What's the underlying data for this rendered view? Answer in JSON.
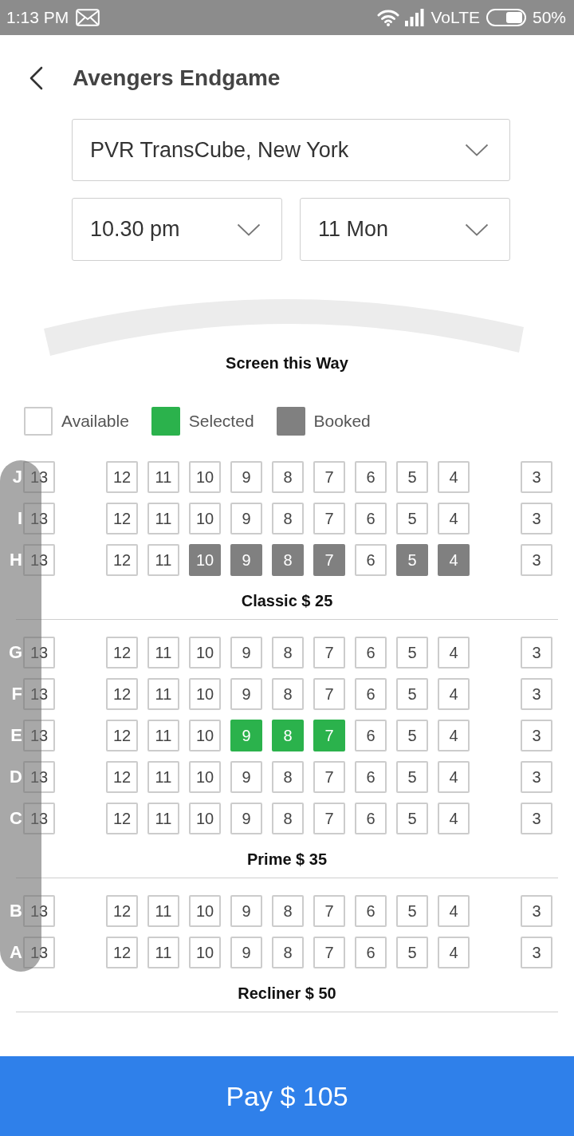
{
  "status_bar": {
    "time": "1:13 PM",
    "network": "VoLTE",
    "battery": "50%"
  },
  "header": {
    "title": "Avengers Endgame"
  },
  "filters": {
    "theatre": {
      "value": "PVR TransCube, New York"
    },
    "show_time": {
      "value": "10.30 pm"
    },
    "show_date": {
      "value": "11 Mon"
    }
  },
  "screen": {
    "label": "Screen this Way"
  },
  "legend": [
    {
      "kind": "available",
      "label": "Available"
    },
    {
      "kind": "selected",
      "label": "Selected"
    },
    {
      "kind": "booked",
      "label": "Booked"
    }
  ],
  "sections": [
    {
      "label": "Classic $ 25",
      "rows": [
        {
          "letter": "J",
          "blocks": [
            {
              "seats": [
                {
                  "number": "13",
                  "selected": false,
                  "booked": false
                }
              ]
            },
            {
              "seats": [
                {
                  "number": "12",
                  "selected": false,
                  "booked": false
                },
                {
                  "number": "11",
                  "selected": false,
                  "booked": false
                },
                {
                  "number": "10",
                  "selected": false,
                  "booked": false
                },
                {
                  "number": "9",
                  "selected": false,
                  "booked": false
                },
                {
                  "number": "8",
                  "selected": false,
                  "booked": false
                },
                {
                  "number": "7",
                  "selected": false,
                  "booked": false
                },
                {
                  "number": "6",
                  "selected": false,
                  "booked": false
                },
                {
                  "number": "5",
                  "selected": false,
                  "booked": false
                },
                {
                  "number": "4",
                  "selected": false,
                  "booked": false
                }
              ]
            },
            {
              "seats": [
                {
                  "number": "3",
                  "selected": false,
                  "booked": false
                }
              ]
            }
          ]
        },
        {
          "letter": "I",
          "blocks": [
            {
              "seats": [
                {
                  "number": "13",
                  "selected": false,
                  "booked": false
                }
              ]
            },
            {
              "seats": [
                {
                  "number": "12",
                  "selected": false,
                  "booked": false
                },
                {
                  "number": "11",
                  "selected": false,
                  "booked": false
                },
                {
                  "number": "10",
                  "selected": false,
                  "booked": false
                },
                {
                  "number": "9",
                  "selected": false,
                  "booked": false
                },
                {
                  "number": "8",
                  "selected": false,
                  "booked": false
                },
                {
                  "number": "7",
                  "selected": false,
                  "booked": false
                },
                {
                  "number": "6",
                  "selected": false,
                  "booked": false
                },
                {
                  "number": "5",
                  "selected": false,
                  "booked": false
                },
                {
                  "number": "4",
                  "selected": false,
                  "booked": false
                }
              ]
            },
            {
              "seats": [
                {
                  "number": "3",
                  "selected": false,
                  "booked": false
                }
              ]
            }
          ]
        },
        {
          "letter": "H",
          "blocks": [
            {
              "seats": [
                {
                  "number": "13",
                  "selected": false,
                  "booked": false
                }
              ]
            },
            {
              "seats": [
                {
                  "number": "12",
                  "selected": false,
                  "booked": false
                },
                {
                  "number": "11",
                  "selected": false,
                  "booked": false
                },
                {
                  "number": "10",
                  "selected": false,
                  "booked": true
                },
                {
                  "number": "9",
                  "selected": false,
                  "booked": true
                },
                {
                  "number": "8",
                  "selected": false,
                  "booked": true
                },
                {
                  "number": "7",
                  "selected": false,
                  "booked": true
                },
                {
                  "number": "6",
                  "selected": false,
                  "booked": false
                },
                {
                  "number": "5",
                  "selected": false,
                  "booked": true
                },
                {
                  "number": "4",
                  "selected": false,
                  "booked": true
                }
              ]
            },
            {
              "seats": [
                {
                  "number": "3",
                  "selected": false,
                  "booked": false
                }
              ]
            }
          ]
        }
      ]
    },
    {
      "label": "Prime $ 35",
      "rows": [
        {
          "letter": "G",
          "blocks": [
            {
              "seats": [
                {
                  "number": "13",
                  "selected": false,
                  "booked": false
                }
              ]
            },
            {
              "seats": [
                {
                  "number": "12",
                  "selected": false,
                  "booked": false
                },
                {
                  "number": "11",
                  "selected": false,
                  "booked": false
                },
                {
                  "number": "10",
                  "selected": false,
                  "booked": false
                },
                {
                  "number": "9",
                  "selected": false,
                  "booked": false
                },
                {
                  "number": "8",
                  "selected": false,
                  "booked": false
                },
                {
                  "number": "7",
                  "selected": false,
                  "booked": false
                },
                {
                  "number": "6",
                  "selected": false,
                  "booked": false
                },
                {
                  "number": "5",
                  "selected": false,
                  "booked": false
                },
                {
                  "number": "4",
                  "selected": false,
                  "booked": false
                }
              ]
            },
            {
              "seats": [
                {
                  "number": "3",
                  "selected": false,
                  "booked": false
                }
              ]
            }
          ]
        },
        {
          "letter": "F",
          "blocks": [
            {
              "seats": [
                {
                  "number": "13",
                  "selected": false,
                  "booked": false
                }
              ]
            },
            {
              "seats": [
                {
                  "number": "12",
                  "selected": false,
                  "booked": false
                },
                {
                  "number": "11",
                  "selected": false,
                  "booked": false
                },
                {
                  "number": "10",
                  "selected": false,
                  "booked": false
                },
                {
                  "number": "9",
                  "selected": false,
                  "booked": false
                },
                {
                  "number": "8",
                  "selected": false,
                  "booked": false
                },
                {
                  "number": "7",
                  "selected": false,
                  "booked": false
                },
                {
                  "number": "6",
                  "selected": false,
                  "booked": false
                },
                {
                  "number": "5",
                  "selected": false,
                  "booked": false
                },
                {
                  "number": "4",
                  "selected": false,
                  "booked": false
                }
              ]
            },
            {
              "seats": [
                {
                  "number": "3",
                  "selected": false,
                  "booked": false
                }
              ]
            }
          ]
        },
        {
          "letter": "E",
          "blocks": [
            {
              "seats": [
                {
                  "number": "13",
                  "selected": false,
                  "booked": false
                }
              ]
            },
            {
              "seats": [
                {
                  "number": "12",
                  "selected": false,
                  "booked": false
                },
                {
                  "number": "11",
                  "selected": false,
                  "booked": false
                },
                {
                  "number": "10",
                  "selected": false,
                  "booked": false
                },
                {
                  "number": "9",
                  "selected": true,
                  "booked": false
                },
                {
                  "number": "8",
                  "selected": true,
                  "booked": false
                },
                {
                  "number": "7",
                  "selected": true,
                  "booked": false
                },
                {
                  "number": "6",
                  "selected": false,
                  "booked": false
                },
                {
                  "number": "5",
                  "selected": false,
                  "booked": false
                },
                {
                  "number": "4",
                  "selected": false,
                  "booked": false
                }
              ]
            },
            {
              "seats": [
                {
                  "number": "3",
                  "selected": false,
                  "booked": false
                }
              ]
            }
          ]
        },
        {
          "letter": "D",
          "blocks": [
            {
              "seats": [
                {
                  "number": "13",
                  "selected": false,
                  "booked": false
                }
              ]
            },
            {
              "seats": [
                {
                  "number": "12",
                  "selected": false,
                  "booked": false
                },
                {
                  "number": "11",
                  "selected": false,
                  "booked": false
                },
                {
                  "number": "10",
                  "selected": false,
                  "booked": false
                },
                {
                  "number": "9",
                  "selected": false,
                  "booked": false
                },
                {
                  "number": "8",
                  "selected": false,
                  "booked": false
                },
                {
                  "number": "7",
                  "selected": false,
                  "booked": false
                },
                {
                  "number": "6",
                  "selected": false,
                  "booked": false
                },
                {
                  "number": "5",
                  "selected": false,
                  "booked": false
                },
                {
                  "number": "4",
                  "selected": false,
                  "booked": false
                }
              ]
            },
            {
              "seats": [
                {
                  "number": "3",
                  "selected": false,
                  "booked": false
                }
              ]
            }
          ]
        },
        {
          "letter": "C",
          "blocks": [
            {
              "seats": [
                {
                  "number": "13",
                  "selected": false,
                  "booked": false
                }
              ]
            },
            {
              "seats": [
                {
                  "number": "12",
                  "selected": false,
                  "booked": false
                },
                {
                  "number": "11",
                  "selected": false,
                  "booked": false
                },
                {
                  "number": "10",
                  "selected": false,
                  "booked": false
                },
                {
                  "number": "9",
                  "selected": false,
                  "booked": false
                },
                {
                  "number": "8",
                  "selected": false,
                  "booked": false
                },
                {
                  "number": "7",
                  "selected": false,
                  "booked": false
                },
                {
                  "number": "6",
                  "selected": false,
                  "booked": false
                },
                {
                  "number": "5",
                  "selected": false,
                  "booked": false
                },
                {
                  "number": "4",
                  "selected": false,
                  "booked": false
                }
              ]
            },
            {
              "seats": [
                {
                  "number": "3",
                  "selected": false,
                  "booked": false
                }
              ]
            }
          ]
        }
      ]
    },
    {
      "label": "Recliner $ 50",
      "rows": [
        {
          "letter": "B",
          "blocks": [
            {
              "seats": [
                {
                  "number": "13",
                  "selected": false,
                  "booked": false
                }
              ]
            },
            {
              "seats": [
                {
                  "number": "12",
                  "selected": false,
                  "booked": false
                },
                {
                  "number": "11",
                  "selected": false,
                  "booked": false
                },
                {
                  "number": "10",
                  "selected": false,
                  "booked": false
                },
                {
                  "number": "9",
                  "selected": false,
                  "booked": false
                },
                {
                  "number": "8",
                  "selected": false,
                  "booked": false
                },
                {
                  "number": "7",
                  "selected": false,
                  "booked": false
                },
                {
                  "number": "6",
                  "selected": false,
                  "booked": false
                },
                {
                  "number": "5",
                  "selected": false,
                  "booked": false
                },
                {
                  "number": "4",
                  "selected": false,
                  "booked": false
                }
              ]
            },
            {
              "seats": [
                {
                  "number": "3",
                  "selected": false,
                  "booked": false
                }
              ]
            }
          ]
        },
        {
          "letter": "A",
          "blocks": [
            {
              "seats": [
                {
                  "number": "13",
                  "selected": false,
                  "booked": false
                }
              ]
            },
            {
              "seats": [
                {
                  "number": "12",
                  "selected": false,
                  "booked": false
                },
                {
                  "number": "11",
                  "selected": false,
                  "booked": false
                },
                {
                  "number": "10",
                  "selected": false,
                  "booked": false
                },
                {
                  "number": "9",
                  "selected": false,
                  "booked": false
                },
                {
                  "number": "8",
                  "selected": false,
                  "booked": false
                },
                {
                  "number": "7",
                  "selected": false,
                  "booked": false
                },
                {
                  "number": "6",
                  "selected": false,
                  "booked": false
                },
                {
                  "number": "5",
                  "selected": false,
                  "booked": false
                },
                {
                  "number": "4",
                  "selected": false,
                  "booked": false
                }
              ]
            },
            {
              "seats": [
                {
                  "number": "3",
                  "selected": false,
                  "booked": false
                }
              ]
            }
          ]
        }
      ]
    }
  ],
  "pay_button": {
    "label": "Pay $ 105"
  }
}
